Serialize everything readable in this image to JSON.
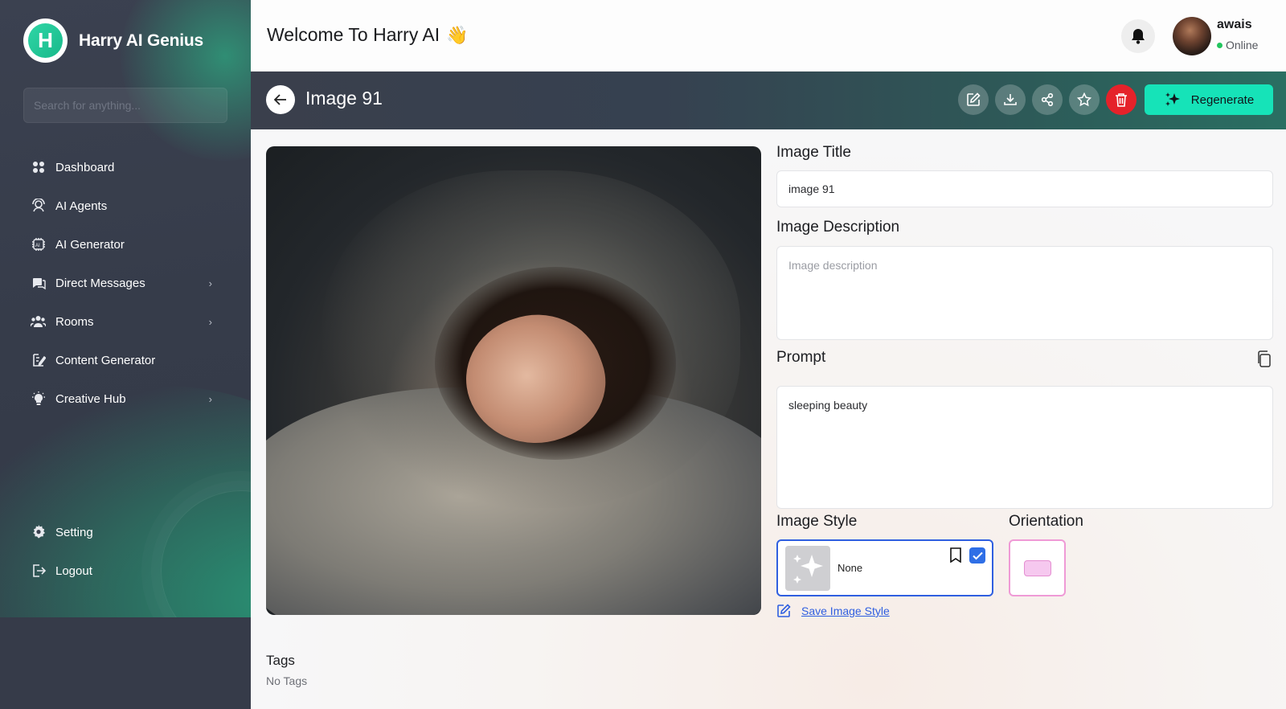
{
  "sidebar": {
    "brand_name": "Harry AI Genius",
    "logo_letter": "H",
    "search_placeholder": "Search for anything...",
    "items": [
      {
        "label": "Dashboard",
        "icon": "dashboard-icon"
      },
      {
        "label": "AI Agents",
        "icon": "agent-icon"
      },
      {
        "label": "AI Generator",
        "icon": "ai-chip-icon"
      },
      {
        "label": "Direct Messages",
        "icon": "messages-icon",
        "has_submenu": true
      },
      {
        "label": "Rooms",
        "icon": "users-icon",
        "has_submenu": true
      },
      {
        "label": "Content Generator",
        "icon": "content-icon"
      },
      {
        "label": "Creative Hub",
        "icon": "bulb-icon",
        "has_submenu": true
      }
    ],
    "bottom_items": [
      {
        "label": "Setting",
        "icon": "gear-icon"
      },
      {
        "label": "Logout",
        "icon": "logout-icon"
      }
    ],
    "chevron": "›"
  },
  "header": {
    "welcome": "Welcome To Harry AI",
    "wave_emoji": "👋",
    "user": {
      "name": "awais",
      "status": "Online"
    }
  },
  "page": {
    "title": "Image 91",
    "actions": [
      "edit",
      "download",
      "share",
      "favorite",
      "delete"
    ],
    "regenerate_label": "Regenerate"
  },
  "form": {
    "title_label": "Image Title",
    "title_value": "image 91",
    "description_label": "Image Description",
    "description_placeholder": "Image description",
    "description_value": "",
    "prompt_label": "Prompt",
    "prompt_value": "sleeping beauty",
    "style_label": "Image Style",
    "style_name": "None",
    "style_selected": true,
    "orientation_label": "Orientation",
    "orientation_value": "landscape",
    "save_style_label": "Save Image Style",
    "tags_label": "Tags",
    "tags_value": "No Tags"
  },
  "colors": {
    "accent": "#16e3b8",
    "danger": "#e5222a",
    "selected_border": "#2f5fe0",
    "orientation_border": "#ef9ad6",
    "sidebar_bg": "#3b4150"
  }
}
